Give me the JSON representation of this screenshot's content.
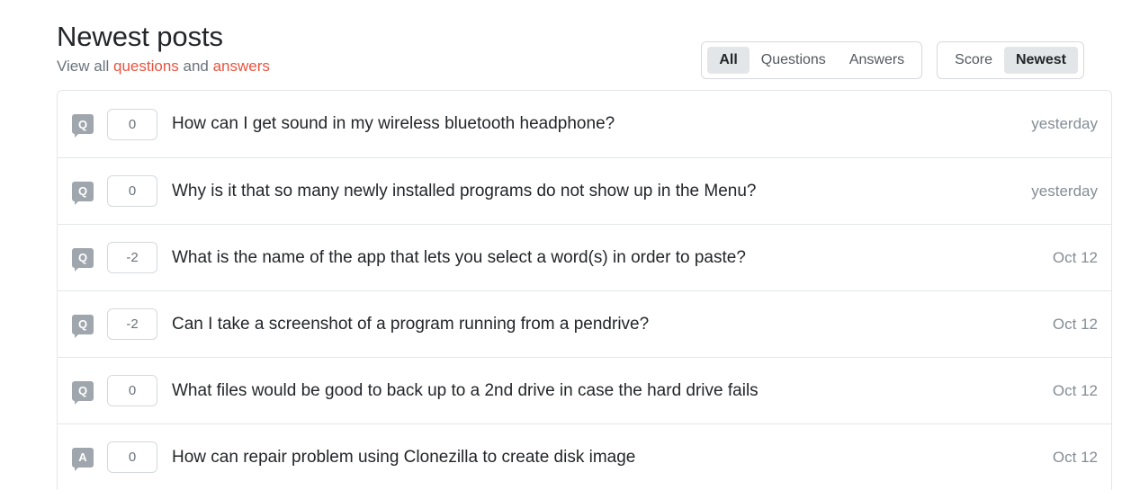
{
  "header": {
    "title": "Newest posts",
    "subtitle_prefix": "View all ",
    "subtitle_link_1": "questions",
    "subtitle_middle": " and ",
    "subtitle_link_2": "answers"
  },
  "filters": {
    "type_group": [
      {
        "label": "All",
        "selected": true
      },
      {
        "label": "Questions",
        "selected": false
      },
      {
        "label": "Answers",
        "selected": false
      }
    ],
    "sort_group": [
      {
        "label": "Score",
        "selected": false
      },
      {
        "label": "Newest",
        "selected": true
      }
    ]
  },
  "posts": [
    {
      "type_icon": "question-icon",
      "type_letter": "Q",
      "score": "0",
      "title": "How can I get sound in my wireless bluetooth headphone?",
      "time": "yesterday"
    },
    {
      "type_icon": "question-icon",
      "type_letter": "Q",
      "score": "0",
      "title": "Why is it that so many newly installed programs do not show up in the Menu?",
      "time": "yesterday"
    },
    {
      "type_icon": "question-icon",
      "type_letter": "Q",
      "score": "-2",
      "title": "What is the name of the app that lets you select a word(s) in order to paste?",
      "time": "Oct 12"
    },
    {
      "type_icon": "question-icon",
      "type_letter": "Q",
      "score": "-2",
      "title": "Can I take a screenshot of a program running from a pendrive?",
      "time": "Oct 12"
    },
    {
      "type_icon": "question-icon",
      "type_letter": "Q",
      "score": "0",
      "title": "What files would be good to back up to a 2nd drive in case the hard drive fails",
      "time": "Oct 12"
    },
    {
      "type_icon": "answer-icon",
      "type_letter": "A",
      "score": "0",
      "title": "How can repair problem using Clonezilla to create disk image",
      "time": "Oct 12"
    }
  ],
  "colors": {
    "link": "#e8543f",
    "text": "#232629",
    "muted": "#6a737c",
    "border": "#e3e6e8",
    "selected_bg": "#e3e6e8",
    "icon_bg": "#9fa6ad"
  }
}
